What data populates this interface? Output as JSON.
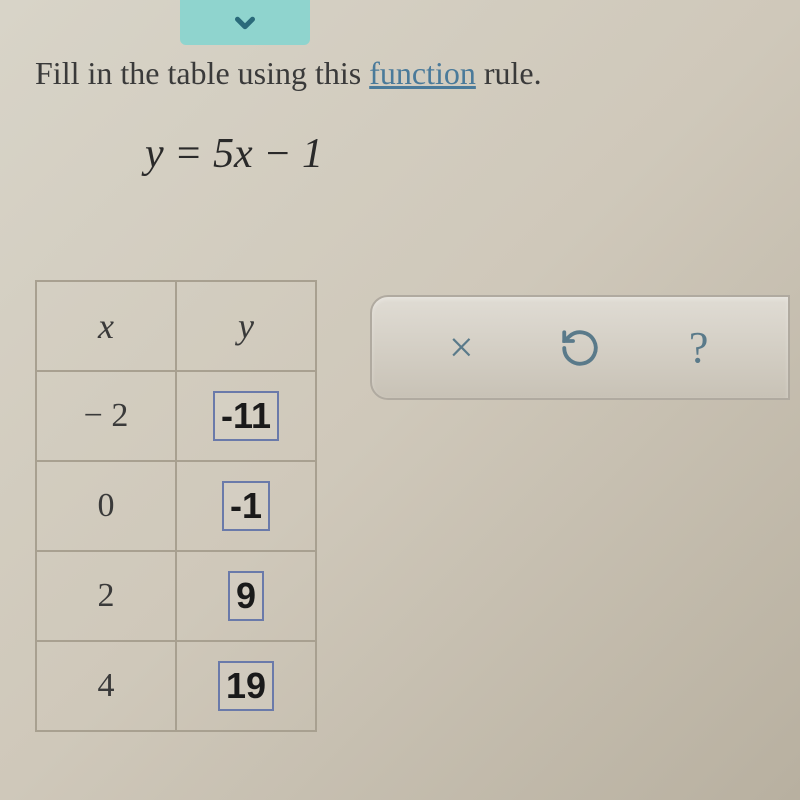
{
  "instruction": {
    "prefix": "Fill in the table using this ",
    "link": "function",
    "suffix": " rule."
  },
  "equation": "y = 5x − 1",
  "table": {
    "headers": {
      "x": "x",
      "y": "y"
    },
    "rows": [
      {
        "x": "− 2",
        "y": "-11"
      },
      {
        "x": "0",
        "y": "-1"
      },
      {
        "x": "2",
        "y": "9"
      },
      {
        "x": "4",
        "y": "19"
      }
    ]
  },
  "toolbar": {
    "cancel": "×",
    "undo": "↺",
    "help": "?"
  }
}
